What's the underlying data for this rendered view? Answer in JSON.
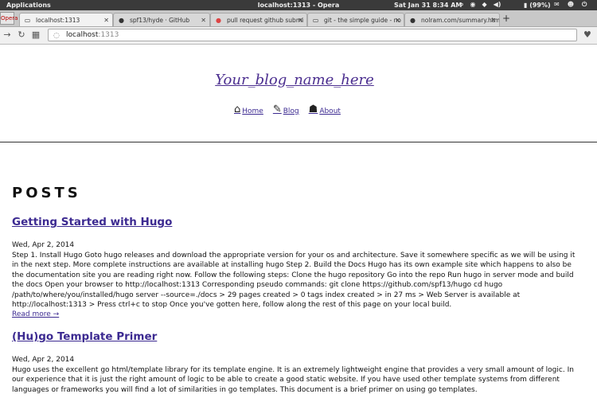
{
  "os_panel": {
    "applications": "Applications",
    "window_title": "localhost:1313 - Opera",
    "datetime": "Sat Jan 31  8:34 AM",
    "battery": "(99%)"
  },
  "browser": {
    "opera_label": "Opera",
    "tabs": [
      {
        "label": "localhost:1313",
        "active": true,
        "icon": "page-icon"
      },
      {
        "label": "spf13/hyde · GitHub",
        "active": false,
        "icon": "github-icon"
      },
      {
        "label": "pull request github submi",
        "active": false,
        "icon": "duckduckgo-icon"
      },
      {
        "label": "git - the simple guide - no",
        "active": false,
        "icon": "page-icon"
      },
      {
        "label": "nolram.com/summary.htm",
        "active": false,
        "icon": "github-icon"
      }
    ],
    "url_host": "localhost",
    "url_port": ":1313"
  },
  "site": {
    "title": "Your_blog_name_here",
    "nav": [
      {
        "label": "Home",
        "icon": "home-icon"
      },
      {
        "label": "Blog",
        "icon": "edit-icon"
      },
      {
        "label": "About",
        "icon": "user-icon"
      }
    ]
  },
  "posts": {
    "heading": "POSTS",
    "items": [
      {
        "title": "Getting Started with Hugo",
        "date": "Wed, Apr 2, 2014",
        "excerpt": "Step 1. Install Hugo Goto hugo releases and download the appropriate version for your os and architecture. Save it somewhere specific as we will be using it in the next step. More complete instructions are available at installing hugo Step 2. Build the Docs Hugo has its own example site which happens to also be the documentation site you are reading right now. Follow the following steps: Clone the hugo repository Go into the repo Run hugo in server mode and build the docs Open your browser to http://localhost:1313 Corresponding pseudo commands: git clone https://github.com/spf13/hugo cd hugo /path/to/where/you/installed/hugo server --source=./docs > 29 pages created > 0 tags index created > in 27 ms > Web Server is available at http://localhost:1313 > Press ctrl+c to stop Once you've gotten here, follow along the rest of this page on your local build.",
        "read_more": "Read more →"
      },
      {
        "title": "(Hu)go Template Primer",
        "date": "Wed, Apr 2, 2014",
        "excerpt": "Hugo uses the excellent go html/template library for its template engine. It is an extremely lightweight engine that provides a very small amount of logic. In our experience that it is just the right amount of logic to be able to create a good static website. If you have used other template systems from different languages or frameworks you will find a lot of similarities in go templates. This document is a brief primer on using go templates."
      }
    ]
  }
}
